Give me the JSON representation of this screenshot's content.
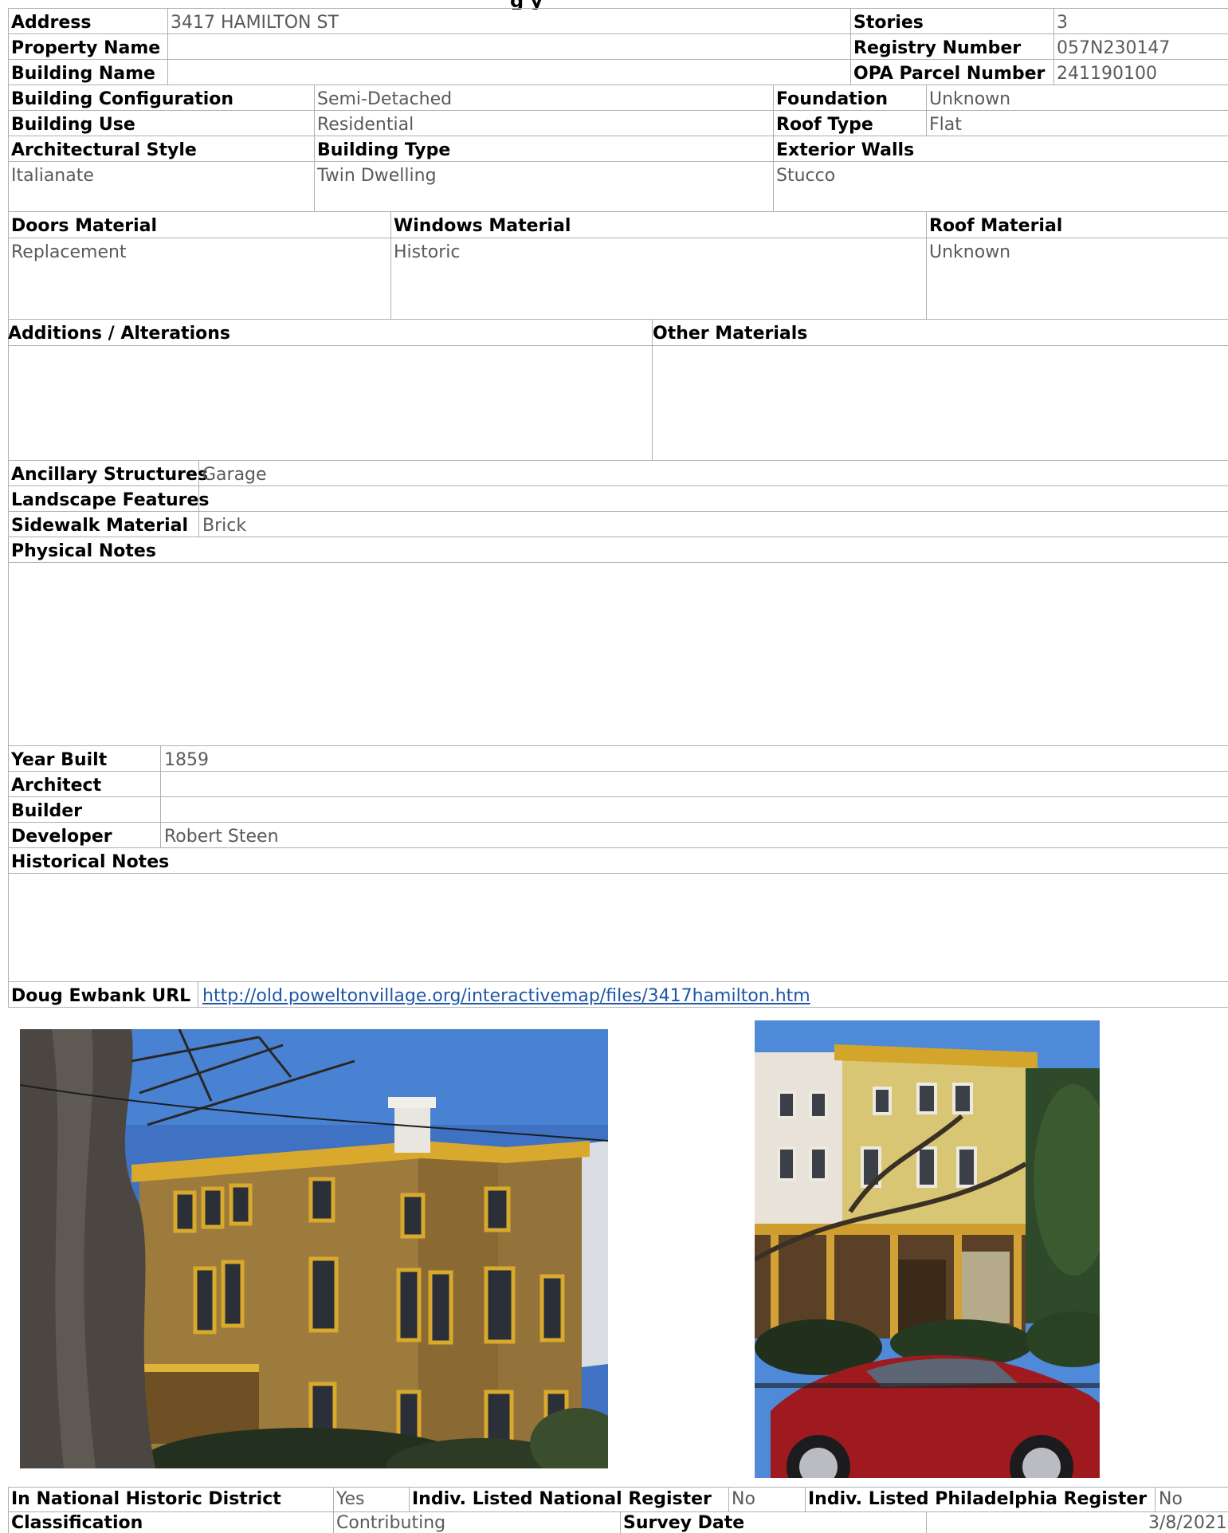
{
  "page": {
    "title_fragment": "g                                         y"
  },
  "property": {
    "address_label": "Address",
    "address": "3417 HAMILTON ST",
    "property_name_label": "Property Name",
    "property_name": "",
    "building_name_label": "Building Name",
    "building_name": "",
    "stories_label": "Stories",
    "stories": "3",
    "registry_label": "Registry Number",
    "registry": "057N230147",
    "opa_label": "OPA Parcel Number",
    "opa": "241190100"
  },
  "building": {
    "config_label": "Building Configuration",
    "config": "Semi-Detached",
    "use_label": "Building Use",
    "use": "Residential",
    "foundation_label": "Foundation",
    "foundation": "Unknown",
    "roof_type_label": "Roof Type",
    "roof_type": "Flat",
    "arch_style_label": "Architectural Style",
    "arch_style": "Italianate",
    "building_type_label": "Building Type",
    "building_type": "Twin Dwelling",
    "exterior_label": "Exterior Walls",
    "exterior": "Stucco"
  },
  "materials": {
    "doors_label": "Doors Material",
    "doors": "Replacement",
    "windows_label": "Windows Material",
    "windows": "Historic",
    "roof_label": "Roof Material",
    "roof": "Unknown",
    "additions_label": "Additions / Alterations",
    "additions": "",
    "other_label": "Other Materials",
    "other": ""
  },
  "site": {
    "ancillary_label": "Ancillary Structures",
    "ancillary": "Garage",
    "landscape_label": "Landscape Features",
    "landscape": "",
    "sidewalk_label": "Sidewalk Material",
    "sidewalk": "Brick",
    "physical_notes_label": "Physical Notes",
    "physical_notes": ""
  },
  "history": {
    "year_label": "Year Built",
    "year": "1859",
    "architect_label": "Architect",
    "architect": "",
    "builder_label": "Builder",
    "builder": "",
    "developer_label": "Developer",
    "developer": "Robert Steen",
    "notes_label": "Historical Notes",
    "notes": "",
    "url_label": "Doug Ewbank URL",
    "url": "http://old.poweltonvillage.org/interactivemap/files/3417hamilton.htm"
  },
  "photos": {
    "left_icon": "building-photo-side",
    "right_icon": "building-photo-front"
  },
  "status": {
    "nhd_label": "In National Historic District",
    "nhd": "Yes",
    "nat_reg_label": "Indiv. Listed National Register",
    "nat_reg": "No",
    "phila_reg_label": "Indiv. Listed Philadelphia Register",
    "phila_reg": "No",
    "class_label": "Classification",
    "class": "Contributing",
    "survey_label": "Survey Date",
    "survey": "3/8/2021"
  },
  "colors": {
    "grid": "#b0b0b0",
    "value_text": "#5a5a5a",
    "link": "#1f56a8"
  }
}
